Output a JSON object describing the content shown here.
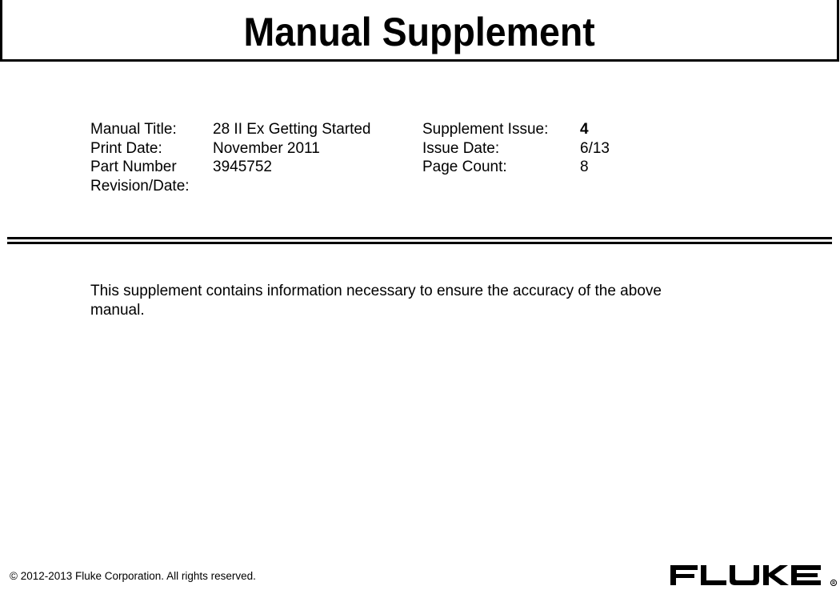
{
  "header": {
    "title": "Manual Supplement"
  },
  "meta_left": [
    {
      "label": "Manual Title:",
      "value": "28 II Ex Getting Started"
    },
    {
      "label": "Print Date:",
      "value": "November 2011"
    },
    {
      "label": "Part Number Revision/Date:",
      "value": "3945752"
    }
  ],
  "meta_left_labels": {
    "part_number_line1": "Part Number",
    "part_number_line2": "Revision/Date:"
  },
  "meta_right": [
    {
      "label": "Supplement Issue:",
      "value": "4"
    },
    {
      "label": "Issue Date:",
      "value": "6/13"
    },
    {
      "label": "Page Count:",
      "value": "8"
    }
  ],
  "body": {
    "paragraph": "This supplement contains information necessary to ensure the accuracy of the above manual."
  },
  "footer": {
    "copyright": "© 2012-2013 Fluke Corporation. All rights reserved.",
    "logo_text": "FLUKE",
    "registered_mark": "®"
  }
}
